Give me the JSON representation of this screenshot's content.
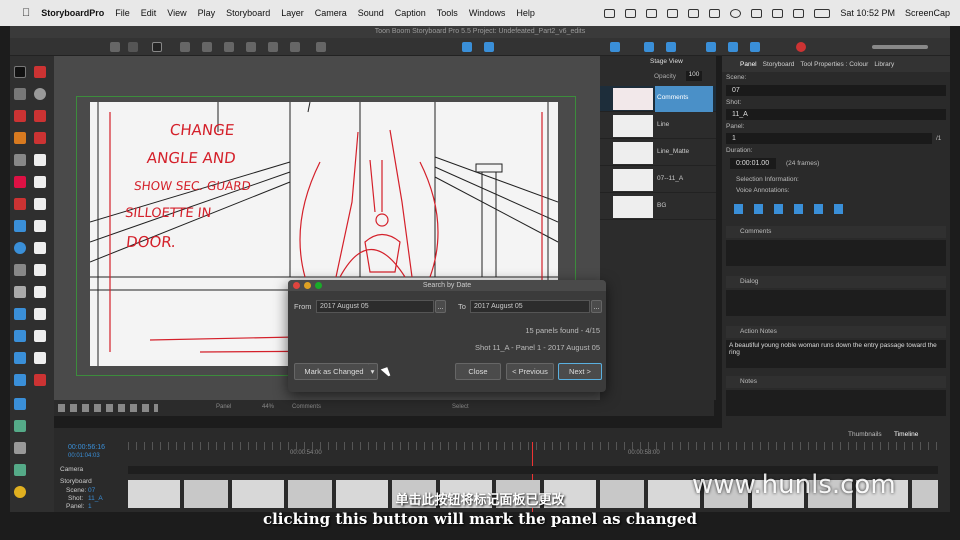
{
  "menubar": {
    "apple": "",
    "app": "StoryboardPro",
    "items": [
      "File",
      "Edit",
      "View",
      "Play",
      "Storyboard",
      "Layer",
      "Camera",
      "Sound",
      "Caption",
      "Tools",
      "Windows",
      "Help"
    ],
    "clock": "Sat 10:52 PM",
    "right_app": "ScreenCap"
  },
  "window_title": "Toon Boom Storyboard Pro 5.5 Project: Undefeated_Part2_v6_edits",
  "stage": {
    "label": "Stage View",
    "opacity_label": "Opacity",
    "opacity_value": "100",
    "zoom": "44%",
    "panel_label": "Panel",
    "comments_label": "Comments",
    "select_label": "Select"
  },
  "sketch_note": [
    "CHANGE",
    "ANGLE AND",
    "SHOW SEC. GUARD",
    "SILLOETTE IN",
    "DOOR."
  ],
  "layers": [
    {
      "name": "Comments",
      "active": true
    },
    {
      "name": "Line",
      "active": false
    },
    {
      "name": "Line_Matte",
      "active": false
    },
    {
      "name": "07--11_A",
      "active": false
    },
    {
      "name": "BG",
      "active": false
    }
  ],
  "right_panel": {
    "tabs": [
      "Panel",
      "Storyboard",
      "Tool Properties : Colour",
      "Library"
    ],
    "scene_label": "Scene:",
    "scene_value": "07",
    "shot_label": "Shot:",
    "shot_value": "11_A",
    "panel_label": "Panel:",
    "panel_value": "1",
    "panel_total": "/1",
    "duration_label": "Duration:",
    "duration_value": "0:00:01.00",
    "duration_frames": "(24 frames)",
    "selection_info": "Selection Information:",
    "voice_annotations": "Voice Annotations:",
    "comments_label": "Comments",
    "dialog_label": "Dialog",
    "action_notes_label": "Action Notes",
    "action_notes_text": "A beautiful young noble woman runs down the entry passage toward the ring",
    "notes_label": "Notes"
  },
  "dialog": {
    "title": "Search by Date",
    "from_label": "From",
    "from_value": "2017 August 05",
    "to_label": "To",
    "to_value": "2017 August 05",
    "browse": "...",
    "found": "15 panels found - 4/15",
    "result": "Shot 11_A - Panel 1 - 2017 August 05",
    "mark_button": "Mark as Changed",
    "close_button": "Close",
    "prev_button": "< Previous",
    "next_button": "Next >"
  },
  "timeline": {
    "tabs": [
      "Thumbnails",
      "Timeline"
    ],
    "timecode_main": "00:00:56:16",
    "timecode_sub": "00:01:04:03",
    "t1": "00:00:54:00",
    "t2": "00:00:58:00",
    "camera_label": "Camera",
    "storyboard_label": "Storyboard",
    "scene_label": "Scene:",
    "scene_value": "07",
    "shot_label": "Shot:",
    "shot_value": "11_A",
    "panel_label": "Panel:",
    "panel_value": "1"
  },
  "subtitle_cn": "单击此按钮将标记面板已更改",
  "subtitle_en": "clicking this button will mark the panel as changed",
  "watermark": "www.hunls.com",
  "colors": {
    "accent_blue": "#3a8fd8",
    "sketch_red": "#d4202a",
    "active_layer": "#4a90c8",
    "dialog_next_border": "#5ab0e0"
  }
}
